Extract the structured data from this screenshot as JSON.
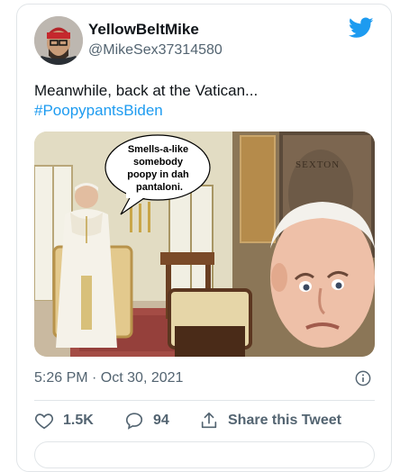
{
  "tweet": {
    "author_name": "YellowBeltMike",
    "author_handle": "@MikeSex37314580",
    "text_line": "Meanwhile, back at the Vatican...",
    "hashtag": "#PoopypantsBiden",
    "timestamp": "5:26 PM · Oct 30, 2021"
  },
  "media": {
    "speech_bubble_lines": [
      "Smells-a-like",
      "somebody",
      "poopy in dah",
      "pantaloni."
    ],
    "painting_caption": "SEXTON"
  },
  "actions": {
    "likes": "1.5K",
    "replies": "94",
    "share_label": "Share this Tweet"
  },
  "icons": {
    "brand": "twitter-bird-icon",
    "info": "info-icon",
    "like": "heart-icon",
    "reply": "reply-bubble-icon",
    "share": "share-icon"
  },
  "colors": {
    "accent": "#1d9bf0",
    "text": "#0f1419",
    "secondary": "#536471",
    "border": "#e1e5e8"
  }
}
